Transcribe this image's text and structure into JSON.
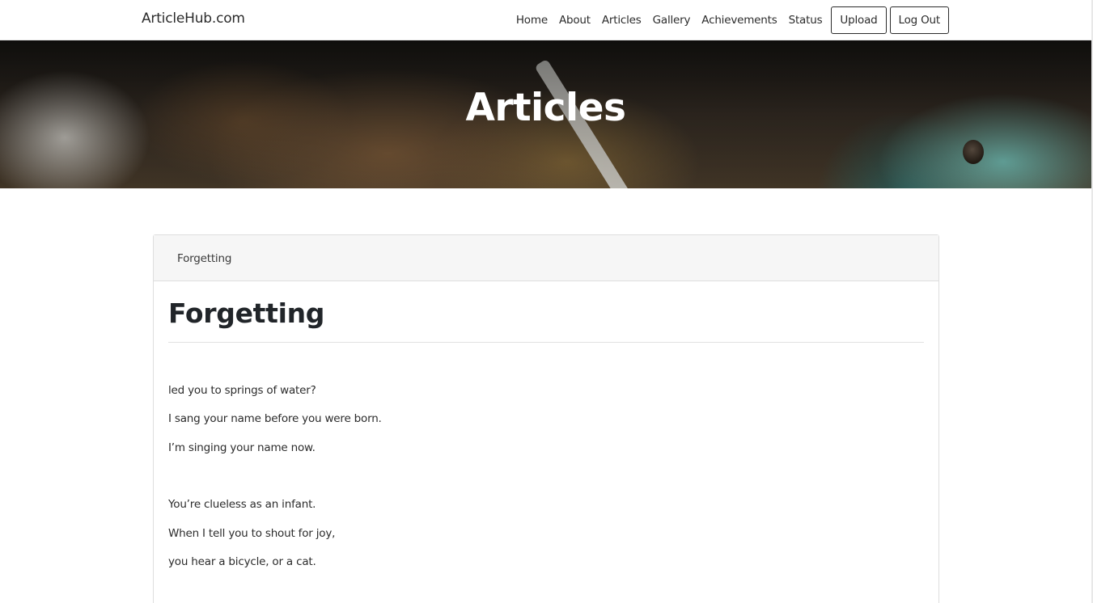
{
  "navbar": {
    "brand": "ArticleHub.com",
    "links": [
      "Home",
      "About",
      "Articles",
      "Gallery",
      "Achievements",
      "Status"
    ],
    "buttons": [
      "Upload",
      "Log Out"
    ]
  },
  "hero": {
    "title": "Articles"
  },
  "article": {
    "breadcrumb": "Forgetting",
    "title": "Forgetting",
    "lines": [
      "led you to springs of water?",
      "I sang your name before you were born.",
      "I’m singing your name now.",
      "You’re clueless as an infant.",
      "When I tell you to shout for joy,",
      "you hear a bicycle, or a cat."
    ]
  }
}
